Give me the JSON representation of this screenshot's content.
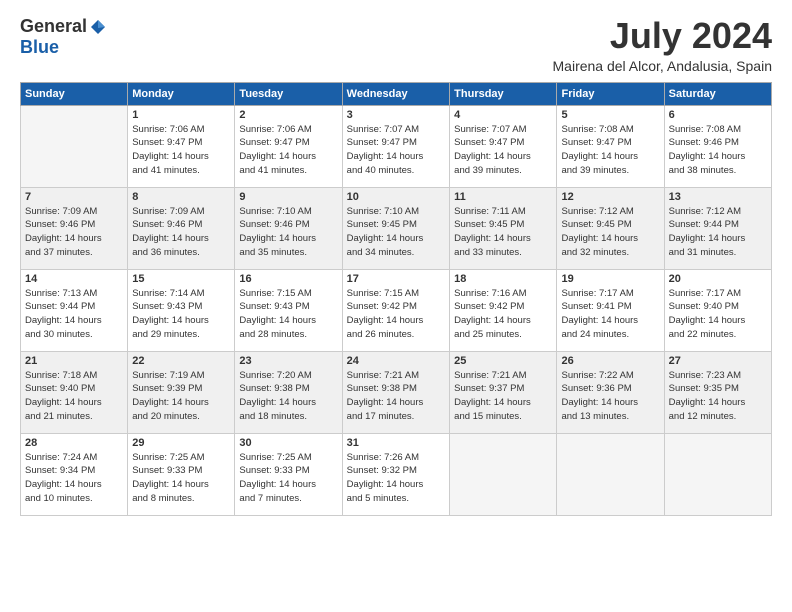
{
  "logo": {
    "general": "General",
    "blue": "Blue"
  },
  "title": "July 2024",
  "subtitle": "Mairena del Alcor, Andalusia, Spain",
  "weekdays": [
    "Sunday",
    "Monday",
    "Tuesday",
    "Wednesday",
    "Thursday",
    "Friday",
    "Saturday"
  ],
  "weeks": [
    [
      {
        "day": "",
        "info": ""
      },
      {
        "day": "1",
        "info": "Sunrise: 7:06 AM\nSunset: 9:47 PM\nDaylight: 14 hours\nand 41 minutes."
      },
      {
        "day": "2",
        "info": "Sunrise: 7:06 AM\nSunset: 9:47 PM\nDaylight: 14 hours\nand 41 minutes."
      },
      {
        "day": "3",
        "info": "Sunrise: 7:07 AM\nSunset: 9:47 PM\nDaylight: 14 hours\nand 40 minutes."
      },
      {
        "day": "4",
        "info": "Sunrise: 7:07 AM\nSunset: 9:47 PM\nDaylight: 14 hours\nand 39 minutes."
      },
      {
        "day": "5",
        "info": "Sunrise: 7:08 AM\nSunset: 9:47 PM\nDaylight: 14 hours\nand 39 minutes."
      },
      {
        "day": "6",
        "info": "Sunrise: 7:08 AM\nSunset: 9:46 PM\nDaylight: 14 hours\nand 38 minutes."
      }
    ],
    [
      {
        "day": "7",
        "info": "Sunrise: 7:09 AM\nSunset: 9:46 PM\nDaylight: 14 hours\nand 37 minutes."
      },
      {
        "day": "8",
        "info": "Sunrise: 7:09 AM\nSunset: 9:46 PM\nDaylight: 14 hours\nand 36 minutes."
      },
      {
        "day": "9",
        "info": "Sunrise: 7:10 AM\nSunset: 9:46 PM\nDaylight: 14 hours\nand 35 minutes."
      },
      {
        "day": "10",
        "info": "Sunrise: 7:10 AM\nSunset: 9:45 PM\nDaylight: 14 hours\nand 34 minutes."
      },
      {
        "day": "11",
        "info": "Sunrise: 7:11 AM\nSunset: 9:45 PM\nDaylight: 14 hours\nand 33 minutes."
      },
      {
        "day": "12",
        "info": "Sunrise: 7:12 AM\nSunset: 9:45 PM\nDaylight: 14 hours\nand 32 minutes."
      },
      {
        "day": "13",
        "info": "Sunrise: 7:12 AM\nSunset: 9:44 PM\nDaylight: 14 hours\nand 31 minutes."
      }
    ],
    [
      {
        "day": "14",
        "info": "Sunrise: 7:13 AM\nSunset: 9:44 PM\nDaylight: 14 hours\nand 30 minutes."
      },
      {
        "day": "15",
        "info": "Sunrise: 7:14 AM\nSunset: 9:43 PM\nDaylight: 14 hours\nand 29 minutes."
      },
      {
        "day": "16",
        "info": "Sunrise: 7:15 AM\nSunset: 9:43 PM\nDaylight: 14 hours\nand 28 minutes."
      },
      {
        "day": "17",
        "info": "Sunrise: 7:15 AM\nSunset: 9:42 PM\nDaylight: 14 hours\nand 26 minutes."
      },
      {
        "day": "18",
        "info": "Sunrise: 7:16 AM\nSunset: 9:42 PM\nDaylight: 14 hours\nand 25 minutes."
      },
      {
        "day": "19",
        "info": "Sunrise: 7:17 AM\nSunset: 9:41 PM\nDaylight: 14 hours\nand 24 minutes."
      },
      {
        "day": "20",
        "info": "Sunrise: 7:17 AM\nSunset: 9:40 PM\nDaylight: 14 hours\nand 22 minutes."
      }
    ],
    [
      {
        "day": "21",
        "info": "Sunrise: 7:18 AM\nSunset: 9:40 PM\nDaylight: 14 hours\nand 21 minutes."
      },
      {
        "day": "22",
        "info": "Sunrise: 7:19 AM\nSunset: 9:39 PM\nDaylight: 14 hours\nand 20 minutes."
      },
      {
        "day": "23",
        "info": "Sunrise: 7:20 AM\nSunset: 9:38 PM\nDaylight: 14 hours\nand 18 minutes."
      },
      {
        "day": "24",
        "info": "Sunrise: 7:21 AM\nSunset: 9:38 PM\nDaylight: 14 hours\nand 17 minutes."
      },
      {
        "day": "25",
        "info": "Sunrise: 7:21 AM\nSunset: 9:37 PM\nDaylight: 14 hours\nand 15 minutes."
      },
      {
        "day": "26",
        "info": "Sunrise: 7:22 AM\nSunset: 9:36 PM\nDaylight: 14 hours\nand 13 minutes."
      },
      {
        "day": "27",
        "info": "Sunrise: 7:23 AM\nSunset: 9:35 PM\nDaylight: 14 hours\nand 12 minutes."
      }
    ],
    [
      {
        "day": "28",
        "info": "Sunrise: 7:24 AM\nSunset: 9:34 PM\nDaylight: 14 hours\nand 10 minutes."
      },
      {
        "day": "29",
        "info": "Sunrise: 7:25 AM\nSunset: 9:33 PM\nDaylight: 14 hours\nand 8 minutes."
      },
      {
        "day": "30",
        "info": "Sunrise: 7:25 AM\nSunset: 9:33 PM\nDaylight: 14 hours\nand 7 minutes."
      },
      {
        "day": "31",
        "info": "Sunrise: 7:26 AM\nSunset: 9:32 PM\nDaylight: 14 hours\nand 5 minutes."
      },
      {
        "day": "",
        "info": ""
      },
      {
        "day": "",
        "info": ""
      },
      {
        "day": "",
        "info": ""
      }
    ]
  ]
}
